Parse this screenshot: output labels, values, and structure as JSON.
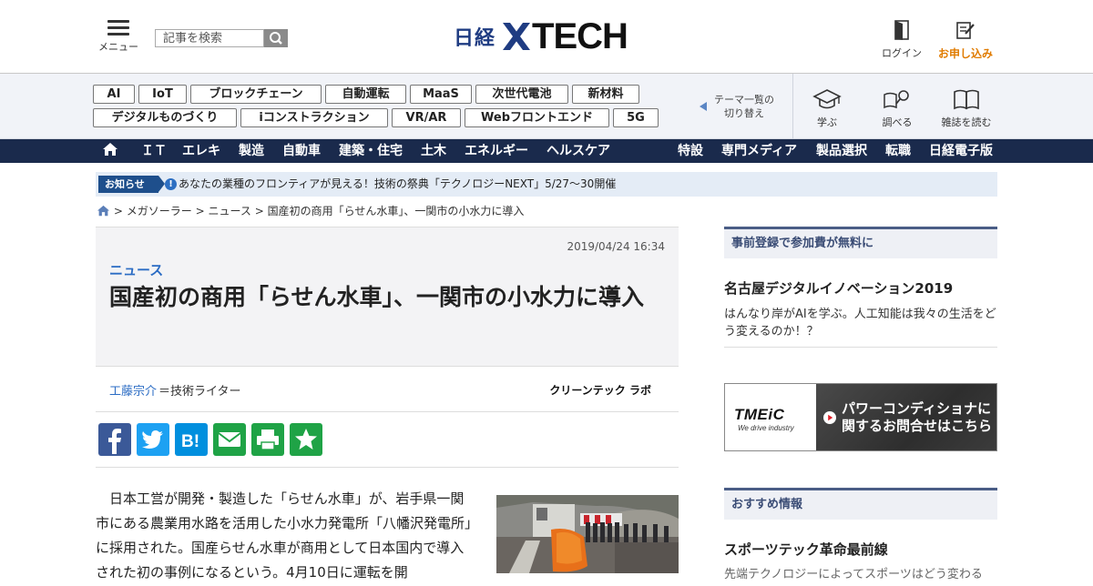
{
  "header": {
    "menu_label": "メニュー",
    "search_placeholder": "記事を検索",
    "logo_nikkei": "日経",
    "logo_tech": "TECH",
    "login_label": "ログイン",
    "subscribe_label": "お申し込み"
  },
  "tags": [
    "AI",
    "IoT",
    "ブロックチェーン",
    "自動運転",
    "MaaS",
    "次世代電池",
    "新材料",
    "デジタルものづくり",
    "iコンストラクション",
    "VR/AR",
    "Webフロントエンド",
    "5G"
  ],
  "theme_switch": {
    "line1": "テーマ一覧の",
    "line2": "切り替え"
  },
  "band_actions": {
    "learn": "学ぶ",
    "research": "調べる",
    "magazine": "雑誌を読む"
  },
  "nav": {
    "left": [
      "ＩＴ",
      "エレキ",
      "製造",
      "自動車",
      "建築・住宅",
      "土木",
      "エネルギー",
      "ヘルスケア"
    ],
    "right": [
      "特設",
      "専門メディア",
      "製品選択",
      "転職",
      "日経電子版"
    ]
  },
  "notice": {
    "badge": "お知らせ",
    "icon": "!",
    "text": "あなたの業種のフロンティアが見える！技術の祭典「テクノロジーNEXT」5/27～30開催"
  },
  "breadcrumb": {
    "items": [
      "メガソーラー",
      "ニュース",
      "国産初の商用「らせん水車」、一関市の小水力に導入"
    ],
    "sep": ">"
  },
  "article": {
    "date": "2019/04/24 16:34",
    "kind": "ニュース",
    "title": "国産初の商用「らせん水車」、一関市の小水力に導入",
    "author": "工藤宗介",
    "author_role": "＝技術ライター",
    "lab": "クリーンテック ラボ",
    "body": "日本工営が開発・製造した「らせん水車」が、岩手県一関市にある農業用水路を活用した小水力発電所「八幡沢発電所」に採用された。国産らせん水車が商用として日本国内で導入された初の事例になるという。4月10日に運転を開"
  },
  "share": [
    "facebook",
    "twitter",
    "hatena-bookmark",
    "mail",
    "print",
    "bookmark-star"
  ],
  "sidebar": {
    "section1_header": "事前登録で参加費が無料に",
    "item1_title": "名古屋デジタルイノベーション2019",
    "item1_desc": "はんなり岸がAIを学ぶ。人工知能は我々の生活をどう変えるのか！？",
    "ad_logo": "TMEiC",
    "ad_tagline": "We drive industry",
    "ad_line1": "パワーコンディショナに",
    "ad_line2": "関するお問合せはこちら",
    "section2_header": "おすすめ情報",
    "item2_title": "スポーツテック革命最前線",
    "item2_desc": "先端テクノロジーによってスポーツはどう変わる"
  },
  "colors": {
    "nav_bg": "#1a2a4c",
    "accent_blue": "#2b6cc4",
    "subscribe_orange": "#e07b00",
    "facebook": "#3b5998",
    "twitter": "#1da1f2",
    "hatena": "#008fde",
    "mail": "#1fa346",
    "print": "#1fa346",
    "star": "#1fa346"
  }
}
